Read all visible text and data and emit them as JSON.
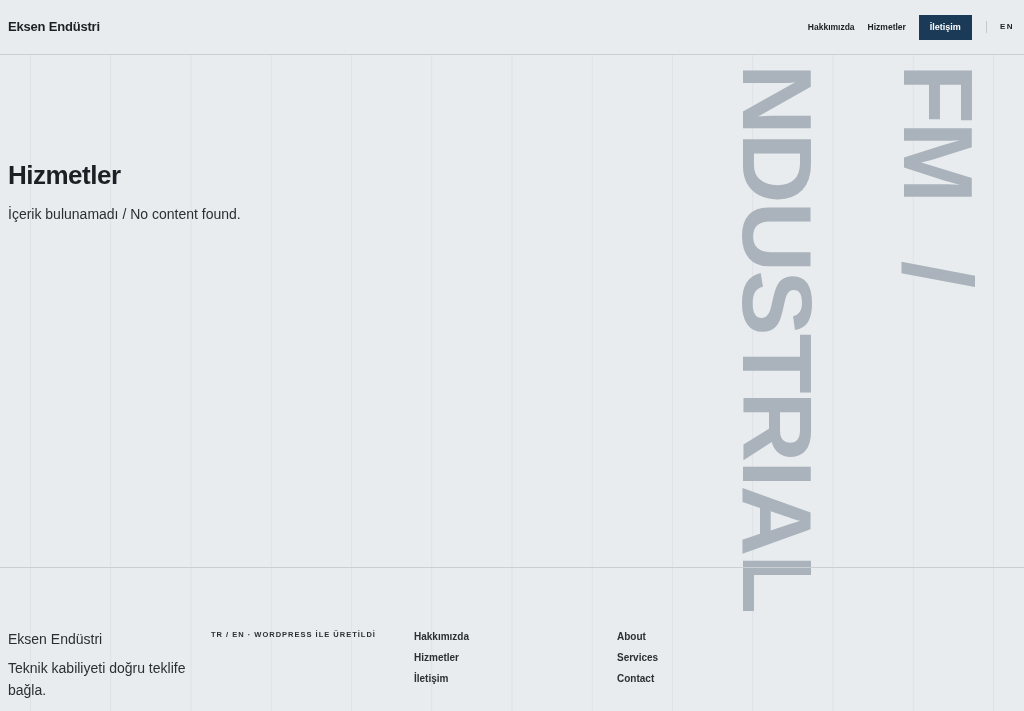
{
  "header": {
    "logo": "Eksen Endüstri",
    "nav": [
      {
        "label": "Hakkımızda",
        "kind": "link"
      },
      {
        "label": "Hizmetler",
        "kind": "link"
      },
      {
        "label": "İletişim",
        "kind": "cta"
      }
    ],
    "language": {
      "label": "EN",
      "selected": false
    }
  },
  "watermark": {
    "lines": [
      "FM /",
      "NDUSTRIAL"
    ]
  },
  "page": {
    "title": "Hizmetler",
    "message": "İçerik bulunamadı / No content found."
  },
  "footer": {
    "brand": "Eksen Endüstri",
    "tagline": "Teknik kabiliyeti doğru teklife bağla.",
    "credit": "TR / EN · WORDPRESS İLE ÜRETİLDİ",
    "links_tr": [
      "Hakkımızda",
      "Hizmetler",
      "İletişim"
    ],
    "links_en": [
      "About",
      "Services",
      "Contact"
    ]
  }
}
